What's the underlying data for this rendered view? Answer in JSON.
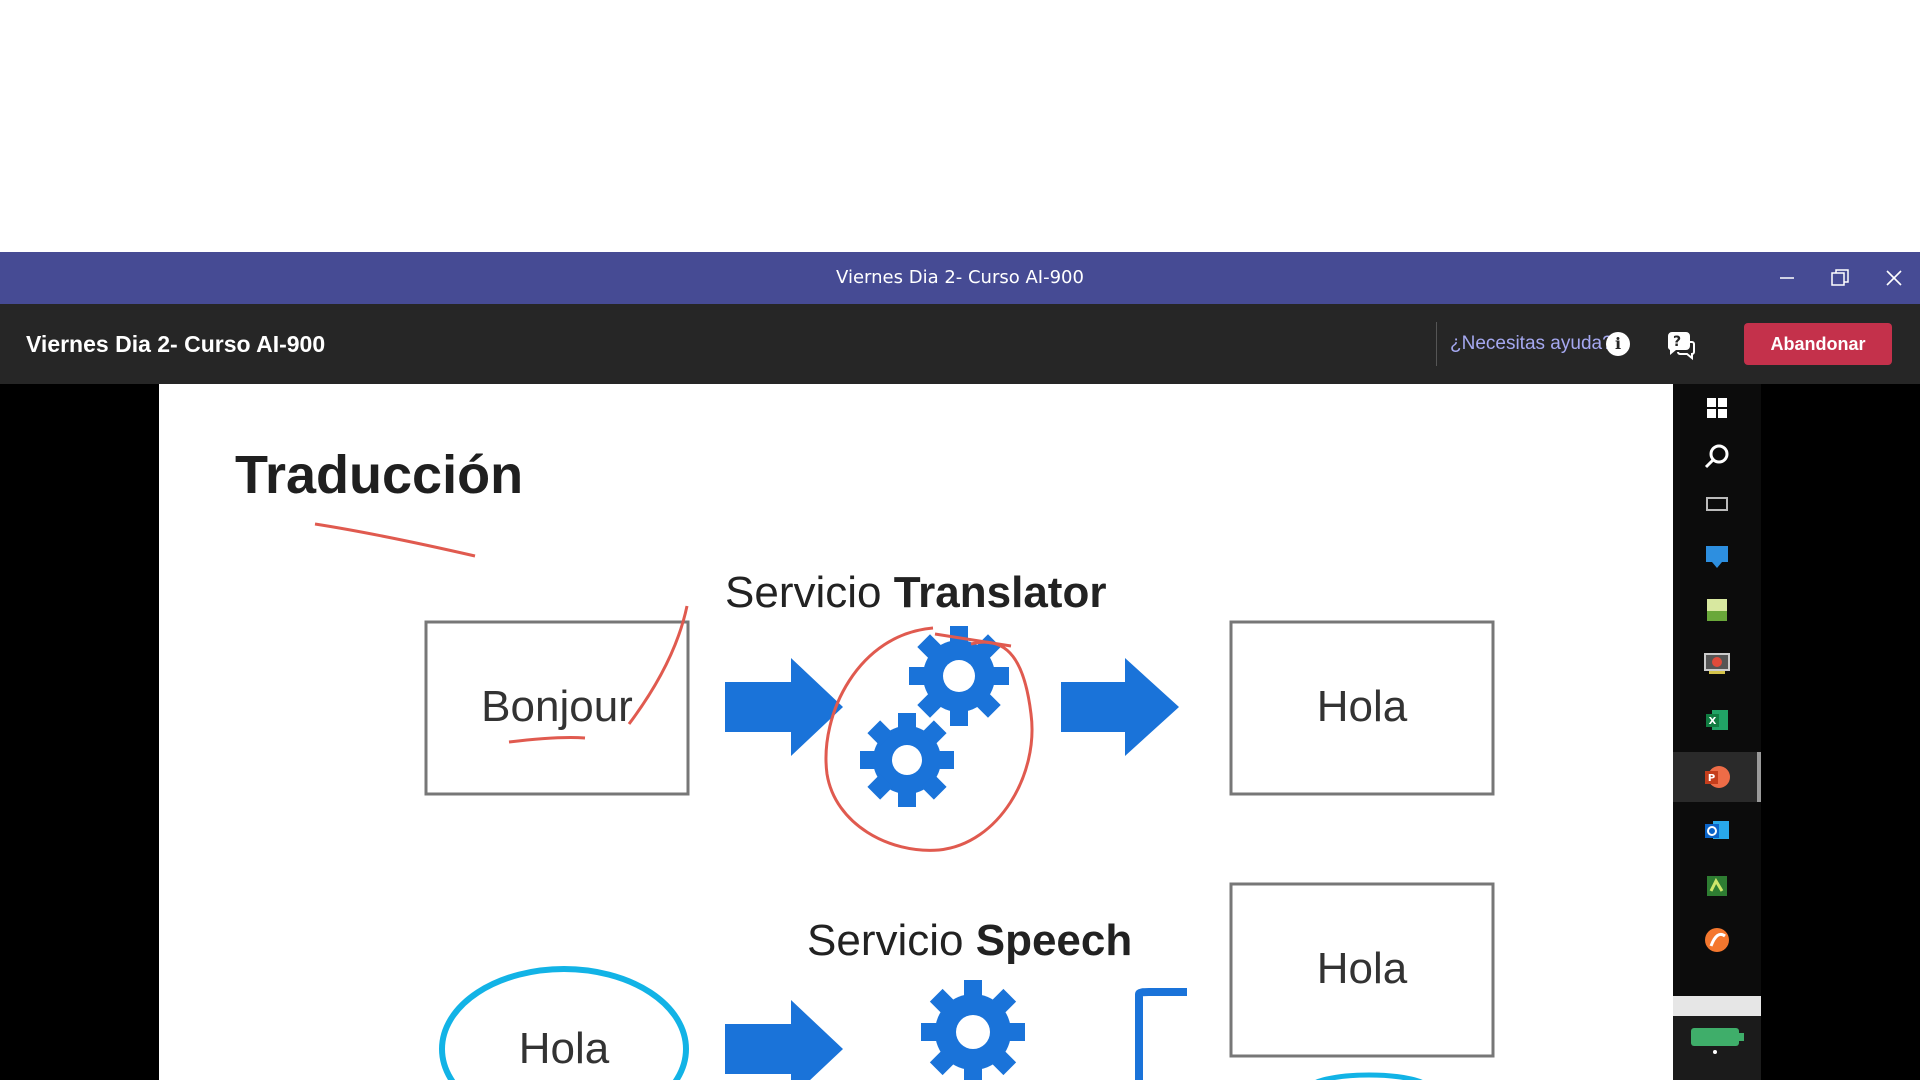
{
  "window": {
    "title": "Viernes Dia 2- Curso AI-900",
    "minimize_icon": "minimize-icon",
    "restore_icon": "restore-icon",
    "close_icon": "close-icon"
  },
  "meeting": {
    "title": "Viernes Dia 2- Curso AI-900",
    "help_text": "¿Necesitas ayuda?",
    "info_icon": "i",
    "leave_label": "Abandonar",
    "accent_color": "#464b94",
    "leave_color": "#c4314b"
  },
  "slide": {
    "title": "Traducción",
    "translator": {
      "label_prefix": "Servicio ",
      "label_bold": "Translator",
      "input_word": "Bonjour",
      "output_word": "Hola"
    },
    "speech": {
      "label_prefix": "Servicio ",
      "label_bold": "Speech",
      "input_word": "Hola",
      "output_word": "Hola"
    }
  },
  "taskbar": {
    "icons": [
      "windows-icon",
      "search-icon",
      "task-view-icon",
      "app-icon",
      "notes-icon",
      "media-icon",
      "excel-icon",
      "powerpoint-icon",
      "outlook-icon",
      "app2-icon",
      "app3-icon"
    ],
    "active": "powerpoint-icon"
  }
}
